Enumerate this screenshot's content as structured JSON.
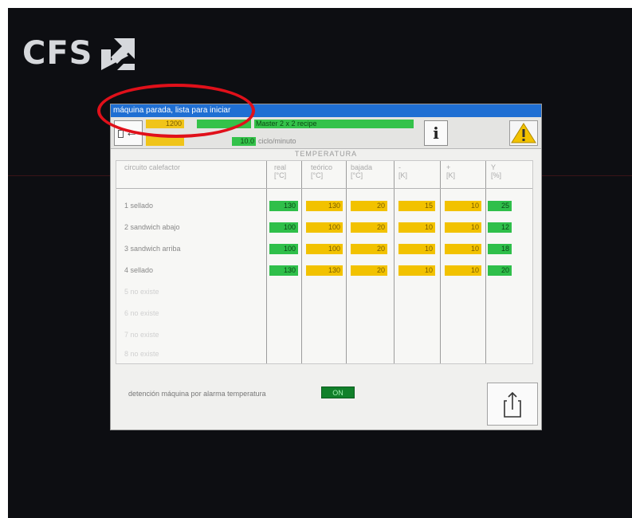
{
  "brand": {
    "logo_text": "CFS"
  },
  "window": {
    "status_title": "máquina parada, lista para iniciar"
  },
  "topbar": {
    "counter_value": "1200",
    "recipe_name": "Master 2 x 2 recipe",
    "speed_value": "10.0",
    "speed_unit": "ciclo/minuto"
  },
  "section": {
    "title": "TEMPERATURA"
  },
  "table": {
    "columns": [
      {
        "key": "circuito",
        "label": "circuito calefactor",
        "unit": ""
      },
      {
        "key": "real",
        "label": "real",
        "unit": "[°C]"
      },
      {
        "key": "teorico",
        "label": "teórico",
        "unit": "[°C]"
      },
      {
        "key": "bajada",
        "label": "bajada",
        "unit": "[°C]"
      },
      {
        "key": "minus",
        "label": "-",
        "unit": "[K]"
      },
      {
        "key": "plus",
        "label": "+",
        "unit": "[K]"
      },
      {
        "key": "y",
        "label": "Y",
        "unit": "[%]"
      }
    ],
    "rows": [
      {
        "name": "1 sellado",
        "real": "130",
        "teorico": "130",
        "bajada": "20",
        "minus": "15",
        "plus": "10",
        "y": "25"
      },
      {
        "name": "2 sandwich abajo",
        "real": "100",
        "teorico": "100",
        "bajada": "20",
        "minus": "10",
        "plus": "10",
        "y": "12"
      },
      {
        "name": "3 sandwich arriba",
        "real": "100",
        "teorico": "100",
        "bajada": "20",
        "minus": "10",
        "plus": "10",
        "y": "18"
      },
      {
        "name": "4 sellado",
        "real": "130",
        "teorico": "130",
        "bajada": "20",
        "minus": "10",
        "plus": "10",
        "y": "20"
      }
    ],
    "unused_rows": [
      "5 no existe",
      "6 no existe",
      "7 no existe",
      "8 no existe"
    ]
  },
  "footer": {
    "alarm_stop_label": "detención máquina por alarma temperatura",
    "alarm_stop_toggle": "ON"
  },
  "colors": {
    "title_bar": "#1f6fd3",
    "green_ok": "#2fbf4a",
    "yellow_set": "#f2c200",
    "annotation": "#e0101a"
  }
}
